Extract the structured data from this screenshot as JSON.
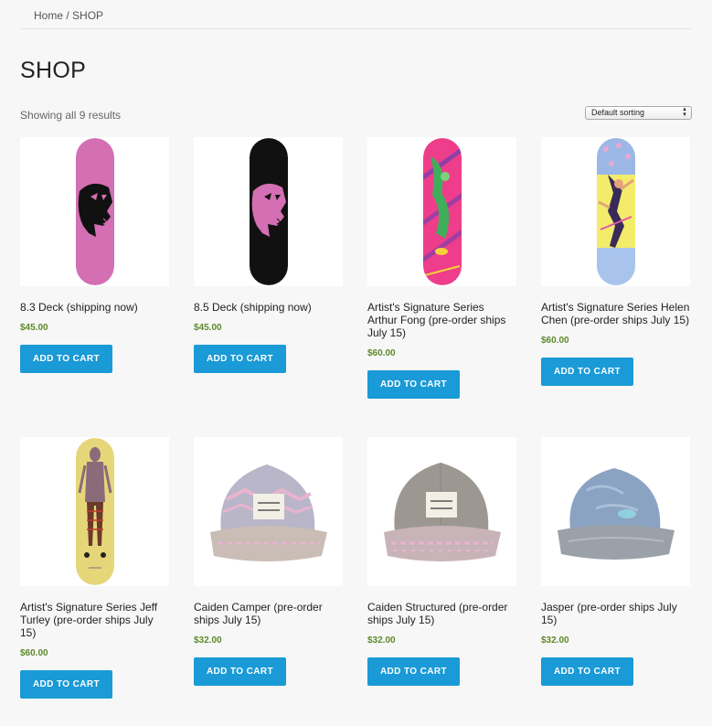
{
  "breadcrumb": {
    "home": "Home",
    "separator": " / ",
    "current": "SHOP"
  },
  "page_title": "SHOP",
  "result_count": "Showing all 9 results",
  "sorting": {
    "selected": "Default sorting"
  },
  "products": [
    {
      "title": "8.3 Deck (shipping now)",
      "price": "$45.00",
      "button": "ADD TO CART",
      "image": "skateboard-deck-pink-ghost"
    },
    {
      "title": "8.5 Deck (shipping now)",
      "price": "$45.00",
      "button": "ADD TO CART",
      "image": "skateboard-deck-black-ghost"
    },
    {
      "title": "Artist's Signature Series Arthur Fong (pre-order ships July 15)",
      "price": "$60.00",
      "button": "ADD TO CART",
      "image": "skateboard-deck-arthur-fong"
    },
    {
      "title": "Artist's Signature Series Helen Chen (pre-order ships July 15)",
      "price": "$60.00",
      "button": "ADD TO CART",
      "image": "skateboard-deck-helen-chen"
    },
    {
      "title": "Artist's Signature Series Jeff Turley (pre-order ships July 15)",
      "price": "$60.00",
      "button": "ADD TO CART",
      "image": "skateboard-deck-jeff-turley"
    },
    {
      "title": "Caiden Camper (pre-order ships July 15)",
      "price": "$32.00",
      "button": "ADD TO CART",
      "image": "cap-caiden-camper"
    },
    {
      "title": "Caiden Structured (pre-order ships July 15)",
      "price": "$32.00",
      "button": "ADD TO CART",
      "image": "cap-caiden-structured"
    },
    {
      "title": "Jasper (pre-order ships July 15)",
      "price": "$32.00",
      "button": "ADD TO CART",
      "image": "cap-jasper"
    }
  ],
  "colors": {
    "button": "#1a9ad6",
    "price": "#5c8a2a",
    "background": "#f7f7f7"
  }
}
